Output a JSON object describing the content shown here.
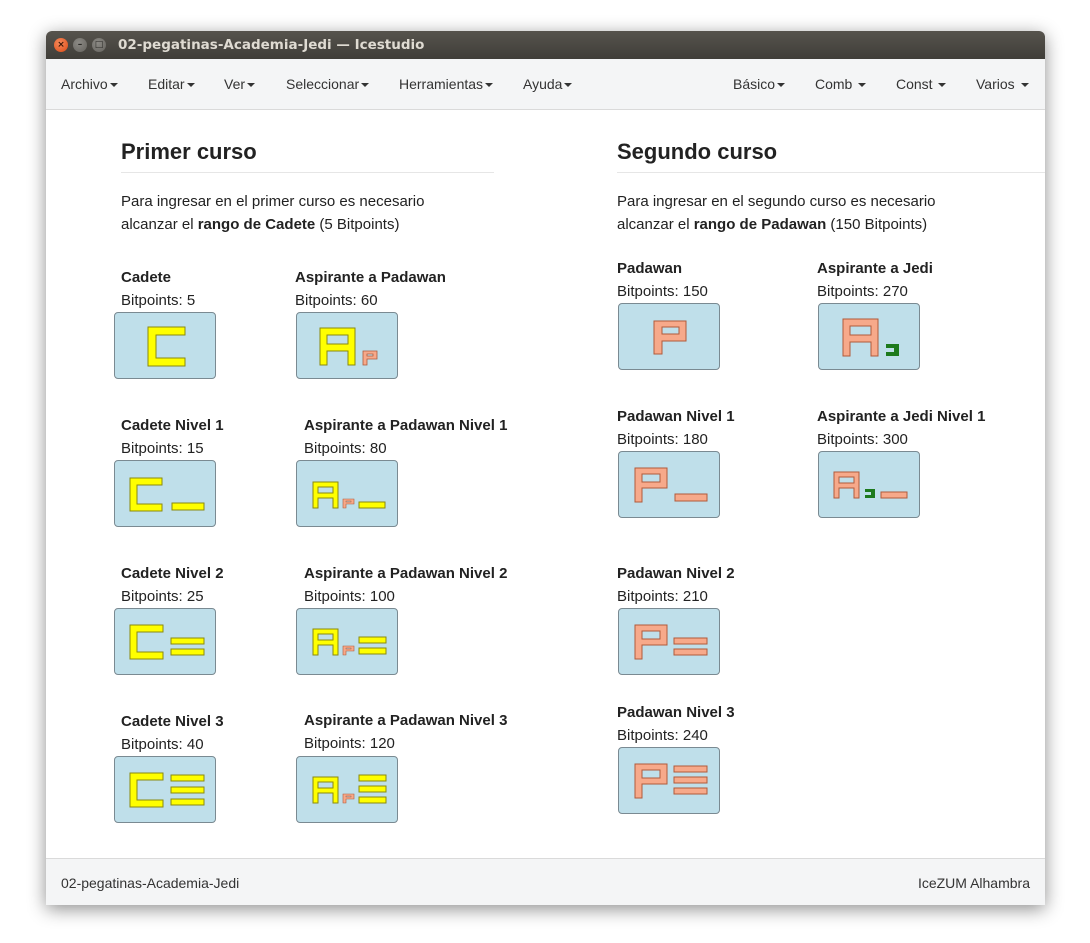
{
  "window": {
    "title": "02-pegatinas-Academia-Jedi — Icestudio",
    "controls": {
      "close": "×",
      "minimize": "–",
      "maximize": "□"
    }
  },
  "menu": {
    "left": [
      "Archivo",
      "Editar",
      "Ver",
      "Seleccionar",
      "Herramientas",
      "Ayuda"
    ],
    "right": [
      "Básico",
      "Comb",
      "Const",
      "Varios"
    ]
  },
  "primer": {
    "title": "Primer curso",
    "line1": "Para ingresar en el primer curso es necesario",
    "line2_pre": "alcanzar el ",
    "line2_bold": "rango de Cadete",
    "line2_post": " (5 Bitpoints)"
  },
  "segundo": {
    "title": "Segundo curso",
    "line1": "Para ingresar en el segundo curso es necesario",
    "line2_pre": "alcanzar el ",
    "line2_bold": "rango de Padawan",
    "line2_post": " (150 Bitpoints)"
  },
  "blocks": [
    {
      "name": "Cadete",
      "bitpoints": "Bitpoints: 5",
      "icon": "cadete-sticker-icon",
      "color": "#ffff00"
    },
    {
      "name": "Aspirante a Padawan",
      "bitpoints": "Bitpoints: 60",
      "icon": "aspirante-padawan-sticker-icon",
      "color": "#ffff00"
    },
    {
      "name": "Cadete Nivel 1",
      "bitpoints": "Bitpoints: 15",
      "icon": "cadete-nivel-1-sticker-icon",
      "color": "#ffff00"
    },
    {
      "name": "Aspirante a Padawan Nivel 1",
      "bitpoints": "Bitpoints: 80",
      "icon": "aspirante-padawan-nivel-1-sticker-icon",
      "color": "#ffff00"
    },
    {
      "name": "Cadete Nivel 2",
      "bitpoints": "Bitpoints: 25",
      "icon": "cadete-nivel-2-sticker-icon",
      "color": "#ffff00"
    },
    {
      "name": "Aspirante a Padawan Nivel 2",
      "bitpoints": "Bitpoints: 100",
      "icon": "aspirante-padawan-nivel-2-sticker-icon",
      "color": "#ffff00"
    },
    {
      "name": "Cadete Nivel 3",
      "bitpoints": "Bitpoints: 40",
      "icon": "cadete-nivel-3-sticker-icon",
      "color": "#ffff00"
    },
    {
      "name": "Aspirante a Padawan Nivel 3",
      "bitpoints": "Bitpoints: 120",
      "icon": "aspirante-padawan-nivel-3-sticker-icon",
      "color": "#ffff00"
    },
    {
      "name": "Padawan",
      "bitpoints": "Bitpoints: 150",
      "icon": "padawan-sticker-icon",
      "color": "#f7a98a"
    },
    {
      "name": "Aspirante a Jedi",
      "bitpoints": "Bitpoints: 270",
      "icon": "aspirante-jedi-sticker-icon",
      "color": "#f7a98a"
    },
    {
      "name": "Padawan Nivel 1",
      "bitpoints": "Bitpoints: 180",
      "icon": "padawan-nivel-1-sticker-icon",
      "color": "#f7a98a"
    },
    {
      "name": "Aspirante a Jedi Nivel 1",
      "bitpoints": "Bitpoints: 300",
      "icon": "aspirante-jedi-nivel-1-sticker-icon",
      "color": "#f7a98a"
    },
    {
      "name": "Padawan Nivel 2",
      "bitpoints": "Bitpoints: 210",
      "icon": "padawan-nivel-2-sticker-icon",
      "color": "#f7a98a"
    },
    {
      "name": "Padawan Nivel 3",
      "bitpoints": "Bitpoints: 240",
      "icon": "padawan-nivel-3-sticker-icon",
      "color": "#f7a98a"
    }
  ],
  "status": {
    "left": "02-pegatinas-Academia-Jedi",
    "right": "IceZUM Alhambra"
  },
  "colors": {
    "box_fill": "#bfdfea",
    "cadete_yellow": "#ffff00",
    "padawan_salmon": "#f7a98a",
    "jedi_green": "#1d7a1d"
  }
}
